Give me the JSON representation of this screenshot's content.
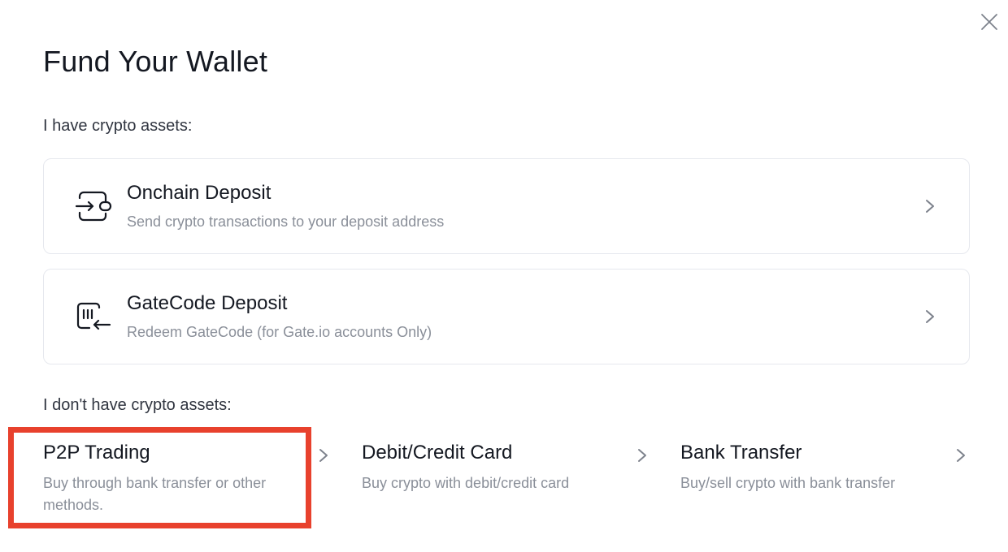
{
  "modal": {
    "title": "Fund Your Wallet",
    "close_icon": "close-icon"
  },
  "have_assets": {
    "label": "I have crypto assets:",
    "options": [
      {
        "title": "Onchain Deposit",
        "description": "Send crypto transactions to your deposit address",
        "icon": "transfer-in-icon"
      },
      {
        "title": "GateCode Deposit",
        "description": "Redeem GateCode (for Gate.io accounts Only)",
        "icon": "code-redeem-icon"
      }
    ]
  },
  "no_assets": {
    "label": "I don't have crypto assets:",
    "options": [
      {
        "title": "P2P Trading",
        "description": "Buy through bank transfer or other methods.",
        "highlighted": true
      },
      {
        "title": "Debit/Credit Card",
        "description": "Buy crypto with debit/credit card"
      },
      {
        "title": "Bank Transfer",
        "description": "Buy/sell crypto with bank transfer"
      }
    ]
  },
  "colors": {
    "text_primary": "#141821",
    "text_secondary": "#8a8f99",
    "border": "#e6e8ee",
    "highlight": "#e8412d"
  }
}
